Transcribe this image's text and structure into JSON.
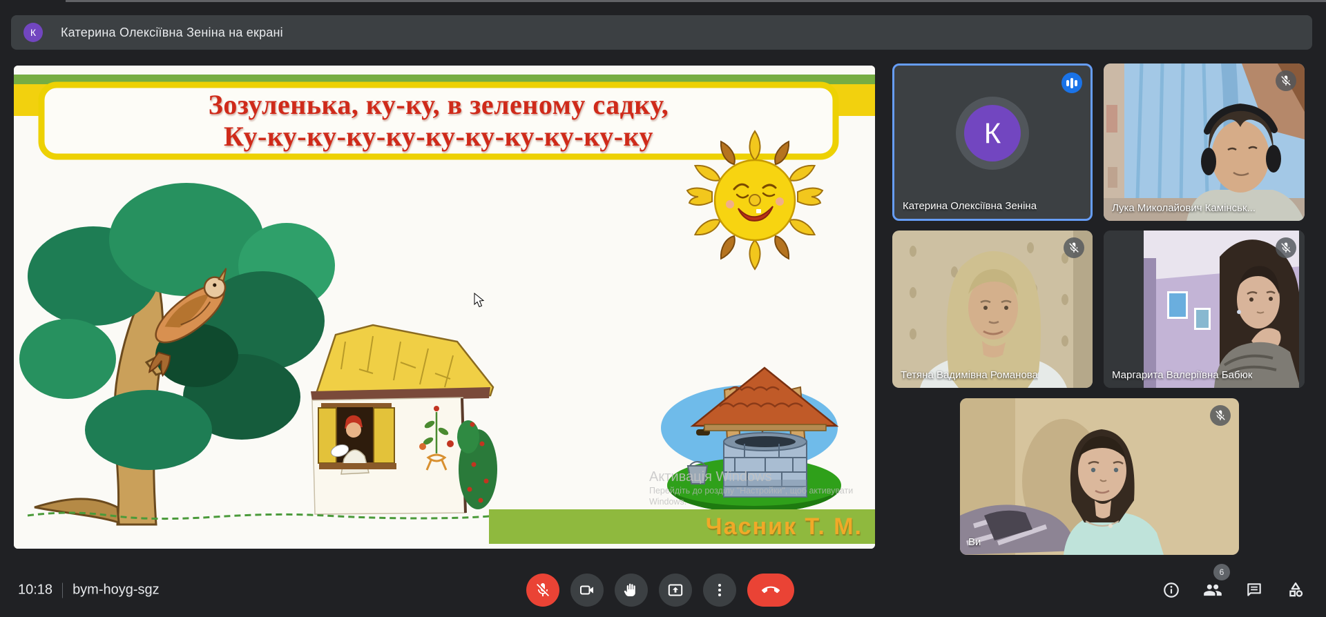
{
  "banner": {
    "avatar_letter": "К",
    "text": "Катерина Олексіївна Зеніна на екрані"
  },
  "slide": {
    "title_line1": "Зозуленька, ку-ку, в зеленому садку,",
    "title_line2": "Ку-ку-ку-ку-ку-ку-ку-ку-ку-ку-ку",
    "credit": "Часник Т. М.",
    "watermark": {
      "line1": "Активація Windows",
      "line2": "Перейдіть до розділу \"Настройки\", щоб активувати",
      "line3": "Windows."
    },
    "illustrations": [
      "sun-with-face",
      "cuckoo-bird-on-tree",
      "thatched-house-with-woman-in-window",
      "water-well"
    ]
  },
  "participants": [
    {
      "name": "Катерина Олексіївна Зеніна",
      "avatar_letter": "К",
      "type": "avatar",
      "speaking": true
    },
    {
      "name": "Лука Миколайович Камінськ...",
      "type": "video",
      "muted": true
    },
    {
      "name": "Тетяна Вадимівна Романова",
      "type": "video",
      "muted": true
    },
    {
      "name": "Маргарита Валеріївна Бабюк",
      "type": "video",
      "muted": true
    },
    {
      "name": "Ви",
      "type": "video",
      "muted": true
    }
  ],
  "bottom_bar": {
    "time": "10:18",
    "meeting_code": "bym-hoyg-sgz",
    "participant_count": "6",
    "controls": [
      {
        "icon": "mic-off-icon",
        "state": "muted-red"
      },
      {
        "icon": "videocam-icon"
      },
      {
        "icon": "raise-hand-icon"
      },
      {
        "icon": "present-screen-icon"
      },
      {
        "icon": "more-options-icon"
      },
      {
        "icon": "end-call-icon",
        "state": "red"
      }
    ],
    "right_icons": [
      {
        "icon": "info-icon"
      },
      {
        "icon": "people-icon",
        "badge": "6"
      },
      {
        "icon": "chat-icon"
      },
      {
        "icon": "activities-icon"
      }
    ]
  },
  "colors": {
    "page_bg": "#202124",
    "surface": "#3c4043",
    "speaking_border_blue": "#669df6",
    "speaking_badge_blue": "#1a73e8",
    "danger_red": "#ea4335",
    "avatar_purple": "#7246c0",
    "slide_green_strip": "#76ad43",
    "slide_yellow_band": "#f2d10e",
    "slide_title_red": "#cf2a1a",
    "credit_green_strip": "#8fb93e",
    "credit_orange": "#f0a928"
  }
}
